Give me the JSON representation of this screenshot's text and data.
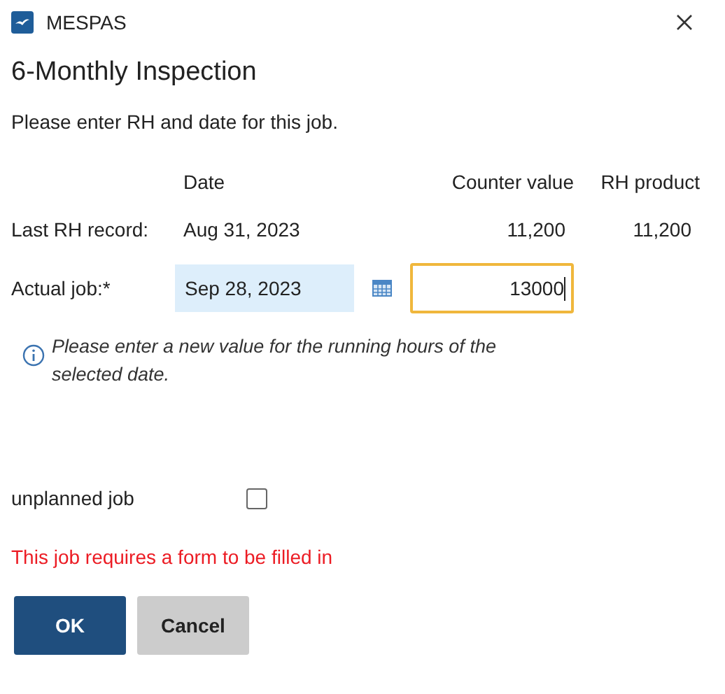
{
  "window": {
    "title": "MESPAS"
  },
  "heading": "6-Monthly Inspection",
  "instruction": "Please enter RH and date for this job.",
  "columns": [
    "Date",
    "Counter value",
    "RH product"
  ],
  "last_record": {
    "label": "Last RH record:",
    "date": "Aug 31, 2023",
    "counter": "11,200",
    "rh_product": "11,200"
  },
  "actual_job": {
    "label": "Actual job:*",
    "date": "Sep 28, 2023",
    "counter": "13000"
  },
  "info": "Please enter a new value for the running hours of the selected date.",
  "unplanned": {
    "label": "unplanned job",
    "checked": false
  },
  "warning": "This job requires a form to be filled in",
  "buttons": [
    {
      "label": "OK",
      "kind": "primary"
    },
    {
      "label": "Cancel",
      "kind": "secondary"
    }
  ]
}
